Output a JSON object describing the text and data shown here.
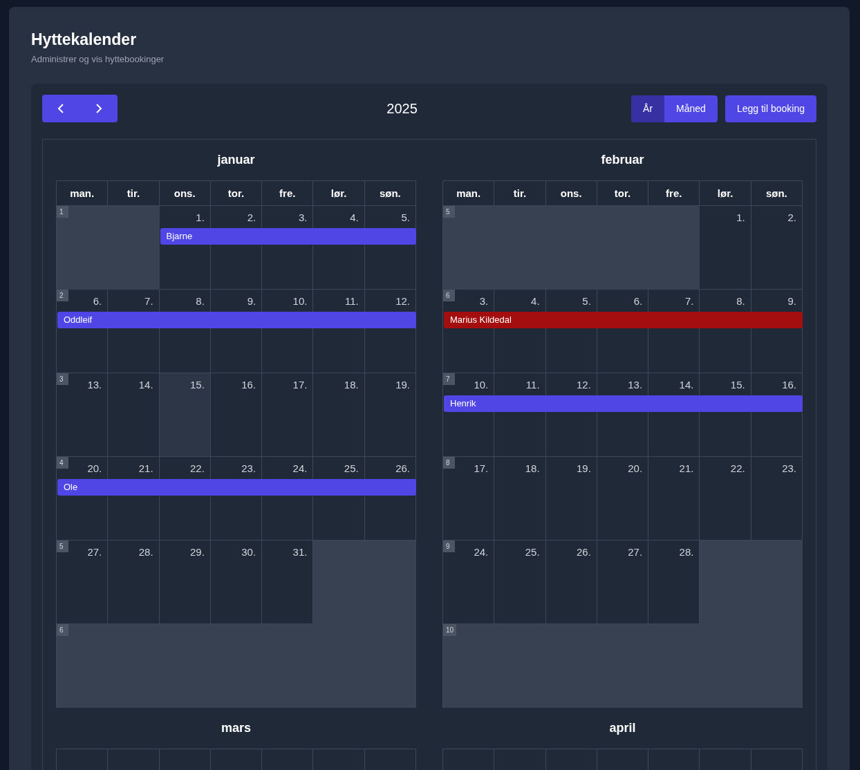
{
  "header": {
    "title": "Hyttekalender",
    "subtitle": "Administrer og vis hyttebookinger"
  },
  "toolbar": {
    "year": "2025",
    "views": [
      {
        "label": "År",
        "selected": true
      },
      {
        "label": "Måned",
        "selected": false
      }
    ],
    "add_button": "Legg til booking"
  },
  "months": [
    {
      "name": "januar",
      "weekdays": [
        "man.",
        "tir.",
        "ons.",
        "tor.",
        "fre.",
        "lør.",
        "søn."
      ],
      "weeks": [
        {
          "number": "1",
          "booking": {
            "name": "Bjarne",
            "color": "#4f46e5"
          },
          "days": [
            {
              "kind": "empty"
            },
            {
              "kind": "empty"
            },
            {
              "kind": "date",
              "date": "1.",
              "today": false
            },
            {
              "kind": "date",
              "date": "2.",
              "today": false
            },
            {
              "kind": "date",
              "date": "3.",
              "today": false
            },
            {
              "kind": "date",
              "date": "4.",
              "today": false
            },
            {
              "kind": "date",
              "date": "5.",
              "today": false
            }
          ]
        },
        {
          "number": "2",
          "booking": {
            "name": "Oddleif",
            "color": "#4f46e5"
          },
          "days": [
            {
              "kind": "date",
              "date": "6.",
              "today": false
            },
            {
              "kind": "date",
              "date": "7.",
              "today": false
            },
            {
              "kind": "date",
              "date": "8.",
              "today": false
            },
            {
              "kind": "date",
              "date": "9.",
              "today": false
            },
            {
              "kind": "date",
              "date": "10.",
              "today": false
            },
            {
              "kind": "date",
              "date": "11.",
              "today": false
            },
            {
              "kind": "date",
              "date": "12.",
              "today": false
            }
          ]
        },
        {
          "number": "3",
          "days": [
            {
              "kind": "date",
              "date": "13.",
              "today": false
            },
            {
              "kind": "date",
              "date": "14.",
              "today": false
            },
            {
              "kind": "date",
              "date": "15.",
              "today": true
            },
            {
              "kind": "date",
              "date": "16.",
              "today": false
            },
            {
              "kind": "date",
              "date": "17.",
              "today": false
            },
            {
              "kind": "date",
              "date": "18.",
              "today": false
            },
            {
              "kind": "date",
              "date": "19.",
              "today": false
            }
          ]
        },
        {
          "number": "4",
          "booking": {
            "name": "Ole",
            "color": "#4f46e5"
          },
          "days": [
            {
              "kind": "date",
              "date": "20.",
              "today": false
            },
            {
              "kind": "date",
              "date": "21.",
              "today": false
            },
            {
              "kind": "date",
              "date": "22.",
              "today": false
            },
            {
              "kind": "date",
              "date": "23.",
              "today": false
            },
            {
              "kind": "date",
              "date": "24.",
              "today": false
            },
            {
              "kind": "date",
              "date": "25.",
              "today": false
            },
            {
              "kind": "date",
              "date": "26.",
              "today": false
            }
          ]
        },
        {
          "number": "5",
          "days": [
            {
              "kind": "date",
              "date": "27.",
              "today": false
            },
            {
              "kind": "date",
              "date": "28.",
              "today": false
            },
            {
              "kind": "date",
              "date": "29.",
              "today": false
            },
            {
              "kind": "date",
              "date": "30.",
              "today": false
            },
            {
              "kind": "date",
              "date": "31.",
              "today": false
            },
            {
              "kind": "empty"
            },
            {
              "kind": "empty"
            }
          ]
        },
        {
          "number": "6",
          "days": [
            {
              "kind": "empty"
            },
            {
              "kind": "empty"
            },
            {
              "kind": "empty"
            },
            {
              "kind": "empty"
            },
            {
              "kind": "empty"
            },
            {
              "kind": "empty"
            },
            {
              "kind": "empty"
            }
          ]
        }
      ]
    },
    {
      "name": "februar",
      "weekdays": [
        "man.",
        "tir.",
        "ons.",
        "tor.",
        "fre.",
        "lør.",
        "søn."
      ],
      "weeks": [
        {
          "number": "5",
          "days": [
            {
              "kind": "empty"
            },
            {
              "kind": "empty"
            },
            {
              "kind": "empty"
            },
            {
              "kind": "empty"
            },
            {
              "kind": "empty"
            },
            {
              "kind": "date",
              "date": "1.",
              "today": false
            },
            {
              "kind": "date",
              "date": "2.",
              "today": false
            }
          ]
        },
        {
          "number": "6",
          "booking": {
            "name": "Marius Kildedal",
            "color": "#a50e0e"
          },
          "days": [
            {
              "kind": "date",
              "date": "3.",
              "today": false
            },
            {
              "kind": "date",
              "date": "4.",
              "today": false
            },
            {
              "kind": "date",
              "date": "5.",
              "today": false
            },
            {
              "kind": "date",
              "date": "6.",
              "today": false
            },
            {
              "kind": "date",
              "date": "7.",
              "today": false
            },
            {
              "kind": "date",
              "date": "8.",
              "today": false
            },
            {
              "kind": "date",
              "date": "9.",
              "today": false
            }
          ]
        },
        {
          "number": "7",
          "booking": {
            "name": "Henrik",
            "color": "#4f46e5"
          },
          "days": [
            {
              "kind": "date",
              "date": "10.",
              "today": false
            },
            {
              "kind": "date",
              "date": "11.",
              "today": false
            },
            {
              "kind": "date",
              "date": "12.",
              "today": false
            },
            {
              "kind": "date",
              "date": "13.",
              "today": false
            },
            {
              "kind": "date",
              "date": "14.",
              "today": false
            },
            {
              "kind": "date",
              "date": "15.",
              "today": false
            },
            {
              "kind": "date",
              "date": "16.",
              "today": false
            }
          ]
        },
        {
          "number": "8",
          "days": [
            {
              "kind": "date",
              "date": "17.",
              "today": false
            },
            {
              "kind": "date",
              "date": "18.",
              "today": false
            },
            {
              "kind": "date",
              "date": "19.",
              "today": false
            },
            {
              "kind": "date",
              "date": "20.",
              "today": false
            },
            {
              "kind": "date",
              "date": "21.",
              "today": false
            },
            {
              "kind": "date",
              "date": "22.",
              "today": false
            },
            {
              "kind": "date",
              "date": "23.",
              "today": false
            }
          ]
        },
        {
          "number": "9",
          "days": [
            {
              "kind": "date",
              "date": "24.",
              "today": false
            },
            {
              "kind": "date",
              "date": "25.",
              "today": false
            },
            {
              "kind": "date",
              "date": "26.",
              "today": false
            },
            {
              "kind": "date",
              "date": "27.",
              "today": false
            },
            {
              "kind": "date",
              "date": "28.",
              "today": false
            },
            {
              "kind": "empty"
            },
            {
              "kind": "empty"
            }
          ]
        },
        {
          "number": "10",
          "days": [
            {
              "kind": "empty"
            },
            {
              "kind": "empty"
            },
            {
              "kind": "empty"
            },
            {
              "kind": "empty"
            },
            {
              "kind": "empty"
            },
            {
              "kind": "empty"
            },
            {
              "kind": "empty"
            }
          ]
        }
      ]
    },
    {
      "name": "mars"
    },
    {
      "name": "april"
    }
  ]
}
